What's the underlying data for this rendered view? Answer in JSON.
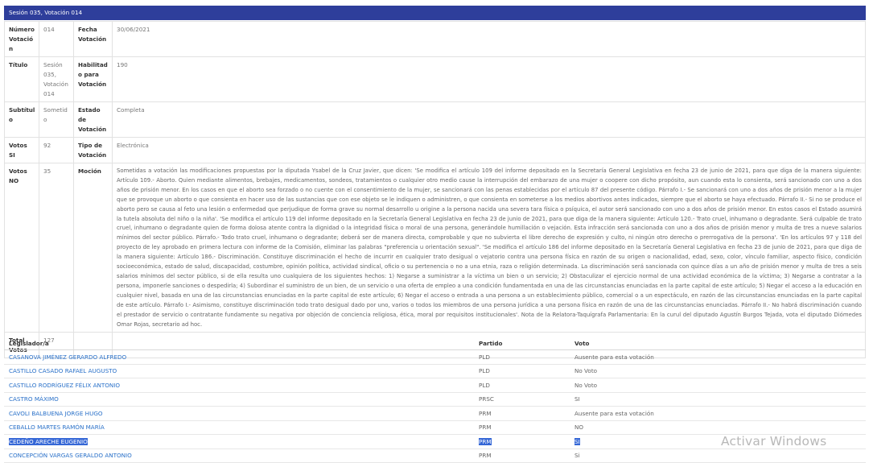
{
  "header": {
    "title": "Sesión 035, Votación 014"
  },
  "details": {
    "numero_label": "Número Votación",
    "numero_value": "014",
    "fecha_label": "Fecha Votación",
    "fecha_value": "30/06/2021",
    "titulo_label": "Título",
    "titulo_value": "Sesión 035, Votación 014",
    "habilitado_label": "Habilitado para Votación",
    "habilitado_value": "190",
    "subtitulo_label": "Subtítulo",
    "subtitulo_value": "Sometido",
    "estado_label": "Estado de Votación",
    "estado_value": "Completa",
    "votos_si_label": "Votos SI",
    "votos_si_value": "92",
    "tipo_label": "Tipo de Votación",
    "tipo_value": "Electrónica",
    "votos_no_label": "Votos NO",
    "votos_no_value": "35",
    "mocion_label": "Moción",
    "mocion_value": "Sometidas a votación las modificaciones propuestas por la diputada Ysabel de la Cruz Javier, que dicen: 'Se modifica el artículo 109 del informe depositado en la Secretaría General Legislativa en fecha 23 de junio de 2021, para que diga de la manera siguiente: Artículo 109.- Aborto. Quien mediante alimentos, brebajes, medicamentos, sondeos, tratamientos o cualquier otro medio cause la interrupción del embarazo de una mujer o coopere con dicho propósito, aun cuando esta lo consienta, será sancionado con uno a dos años de prisión menor. En los casos en que el aborto sea forzado o no cuente con el consentimiento de la mujer, se sancionará con las penas establecidas por el artículo 87 del presente código. Párrafo I.- Se sancionará con uno a dos años de prisión menor a la mujer que se provoque un aborto o que consienta en hacer uso de las sustancias que con ese objeto se le indiquen o administren, o que consienta en someterse a los medios abortivos antes indicados, siempre que el aborto se haya efectuado. Párrafo II.- Si no se produce el aborto pero se causa al feto una lesión o enfermedad que perjudique de forma grave su normal desarrollo u origine a la persona nacida una severa tara física o psíquica, el autor será sancionado con uno a dos años de prisión menor. En estos casos el Estado asumirá la tutela absoluta del niño o la niña'. 'Se modifica el artículo 119 del informe depositado en la Secretaría General Legislativa en fecha 23 de junio de 2021, para que diga de la manera siguiente: Artículo 120.- Trato cruel, inhumano o degradante. Será culpable de trato cruel, inhumano o degradante quien de forma dolosa atente contra la dignidad o la integridad física o moral de una persona, generándole humillación o vejación. Esta infracción será sancionada con uno a dos años de prisión menor y multa de tres a nueve salarios mínimos del sector público. Párrafo.- Todo trato cruel, inhumano o degradante; deberá ser de manera directa, comprobable y que no subvierta el libre derecho de expresión y culto, ni ningún otro derecho o prerrogativa de la persona'. 'En los artículos 97 y 118 del proyecto de ley aprobado en primera lectura con informe de la Comisión, eliminar las palabras \"preferencia u orientación sexual\". 'Se modifica el artículo 186 del informe depositado en la Secretaría General Legislativa en fecha 23 de junio de 2021, para que diga de la manera siguiente: Artículo 186.- Discriminación. Constituye discriminación el hecho de incurrir en cualquier trato desigual o vejatorio contra una persona física en razón de su origen o nacionalidad, edad, sexo, color, vínculo familiar, aspecto físico, condición socioeconómica, estado de salud, discapacidad, costumbre, opinión política, actividad sindical, oficio o su pertenencia o no a una etnia, raza o religión determinada. La discriminación será sancionada con quince días a un año de prisión menor y multa de tres a seis salarios mínimos del sector público, si de ella resulta uno cualquiera de los siguientes hechos: 1) Negarse a suministrar a la víctima un bien o un servicio; 2) Obstaculizar el ejercicio normal de una actividad económica de la víctima; 3) Negarse a contratar a la persona, imponerle sanciones o despedirla; 4) Subordinar el suministro de un bien, de un servicio o una oferta de empleo a una condición fundamentada en una de las circunstancias enunciadas en la parte capital de este artículo; 5) Negar el acceso a la educación en cualquier nivel, basada en una de las circunstancias enunciadas en la parte capital de este artículo; 6) Negar el acceso o entrada a una persona a un establecimiento público, comercial o a un espectáculo, en razón de las circunstancias enunciadas en la parte capital de este artículo. Párrafo I.- Asimismo, constituye discriminación todo trato desigual dado por uno, varios o todos los miembros de una persona jurídica a una persona física en razón de una de las circunstancias enunciadas. Párrafo II.- No habrá discriminación cuando el prestador de servicio o contratante fundamente su negativa por objeción de conciencia religiosa, ética, moral por requisitos institucionales'. Nota de la Relatora-Taquígrafa Parlamentaria: En la curul del diputado Agustín Burgos Tejada, vota el diputado Diómedes Omar Rojas, secretario ad hoc.",
    "total_label": "Total Votos",
    "total_value": "127"
  },
  "votes": {
    "columns": [
      "Legislador/a",
      "Partido",
      "Voto"
    ],
    "rows": [
      {
        "name": "CASANOVA JIMÉNEZ GERARDO ALFREDO",
        "party": "PLD",
        "vote": "Ausente para esta votación"
      },
      {
        "name": "CASTILLO CASADO RAFAEL AUGUSTO",
        "party": "PLD",
        "vote": "No Voto"
      },
      {
        "name": "CASTILLO RODRÍGUEZ FÉLIX ANTONIO",
        "party": "PLD",
        "vote": "No Voto"
      },
      {
        "name": "CASTRO MÁXIMO",
        "party": "PRSC",
        "vote": "SI"
      },
      {
        "name": "CAVOLI BALBUENA JORGE HUGO",
        "party": "PRM",
        "vote": "Ausente para esta votación"
      },
      {
        "name": "CEBALLO MARTES RAMÓN MARÍA",
        "party": "PRM",
        "vote": "NO"
      },
      {
        "name": "CEDEÑO ARECHE EUGENIO",
        "party": "PRM",
        "vote": "SI"
      },
      {
        "name": "CONCEPCIÓN VARGAS GERALDO ANTONIO",
        "party": "PRM",
        "vote": "Si"
      }
    ]
  },
  "watermark": {
    "text": "Activar Windows"
  }
}
